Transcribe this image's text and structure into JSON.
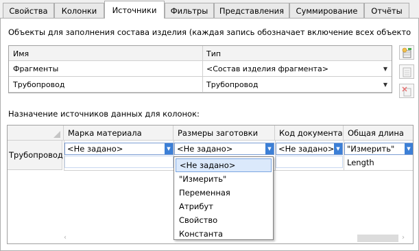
{
  "tabs": [
    {
      "label": "Свойства"
    },
    {
      "label": "Колонки"
    },
    {
      "label": "Источники"
    },
    {
      "label": "Фильтры"
    },
    {
      "label": "Представления"
    },
    {
      "label": "Суммирование"
    },
    {
      "label": "Отчёты"
    }
  ],
  "active_tab": "Источники",
  "description": "Объекты  для  заполнения  состава  изделия (каждая запись обозначает включение всех объектов указан",
  "sources": {
    "headers": [
      "Имя",
      "Тип"
    ],
    "rows": [
      {
        "name": "Фрагменты",
        "type": "<Состав изделия фрагмента>"
      },
      {
        "name": "Трубопровод",
        "type": "Трубопровод"
      }
    ]
  },
  "side_buttons": [
    "add-source-icon",
    "edit-source-icon",
    "delete-source-icon"
  ],
  "columns_label": "Назначение источников данных для колонок:",
  "columns_grid": {
    "headers": [
      "Марка материала",
      "Размеры заготовки",
      "Код документа",
      "Общая длина"
    ],
    "row_header": "Трубопровод",
    "values": [
      "<Не задано>",
      "<Не задано>",
      "<Не задано>",
      "\"Измерить\""
    ],
    "extra_value": "Length"
  },
  "dropdown": {
    "selected": "<Не задано>",
    "options": [
      "<Не задано>",
      "\"Измерить\"",
      "Переменная",
      "Атрибут",
      "Свойство",
      "Константа"
    ]
  },
  "colors": {
    "accent": "#3c7fd6",
    "selection": "#dbe9fb",
    "border": "#a0a0a0"
  }
}
